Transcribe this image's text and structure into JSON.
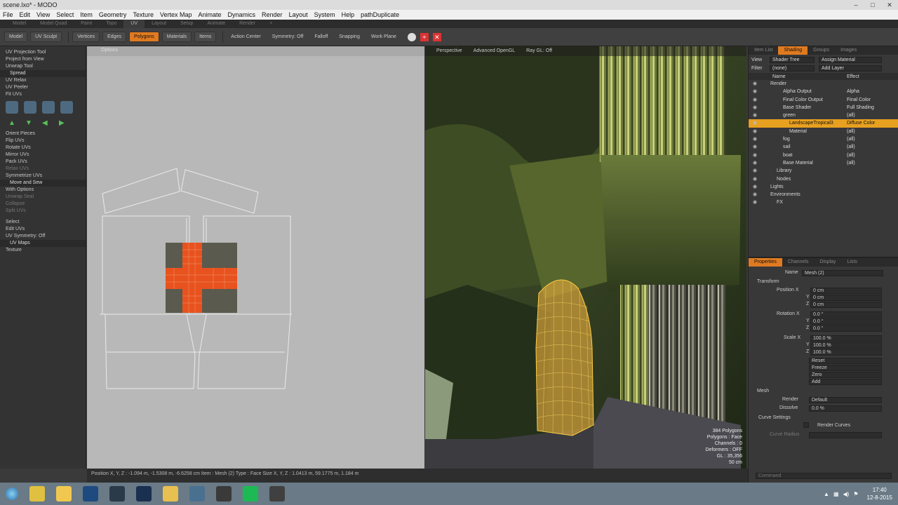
{
  "window": {
    "title": "scene.lxo* - MODO"
  },
  "menu": [
    "File",
    "Edit",
    "View",
    "Select",
    "Item",
    "Geometry",
    "Texture",
    "Vertex Map",
    "Animate",
    "Dynamics",
    "Render",
    "Layout",
    "System",
    "Help",
    "pathDuplicate"
  ],
  "layout_tabs": [
    "Model",
    "Model Quad",
    "Paint",
    "Topo",
    "UV",
    "Layout",
    "Setup",
    "Animate",
    "Render",
    "+"
  ],
  "layout_active": "UV",
  "toolbar": {
    "model": "Model",
    "uv_sculpt": "UV Sculpt",
    "vertices": "Vertices",
    "edges": "Edges",
    "polygons": "Polygons",
    "materials": "Materials",
    "items": "Items",
    "action_center": "Action Center",
    "symmetry": "Symmetry: Off",
    "falloff": "Falloff",
    "snapping": "Snapping",
    "work_plane": "Work Plane"
  },
  "left_panel": {
    "items": [
      {
        "label": "UV Projection Tool"
      },
      {
        "label": "Project from View"
      },
      {
        "label": "Unwrap Tool"
      },
      {
        "label": "Spread",
        "head": true
      },
      {
        "label": "UV Relax"
      },
      {
        "label": "UV Peeler"
      },
      {
        "label": "Fit UVs"
      }
    ],
    "items2": [
      {
        "label": "Orient Pieces"
      },
      {
        "label": "Flip UVs"
      },
      {
        "label": "Rotate UVs"
      },
      {
        "label": "Mirror UVs"
      },
      {
        "label": "Pack UVs"
      },
      {
        "label": "Relax UVs",
        "dim": true
      },
      {
        "label": "Symmetrize UVs"
      },
      {
        "label": "Move and Sew",
        "head": true
      },
      {
        "label": "With Options"
      },
      {
        "label": "Unwrap Seal",
        "dim": true
      },
      {
        "label": "Collapse",
        "dim": true
      },
      {
        "label": "Split UVs",
        "dim": true
      }
    ],
    "items3": [
      {
        "label": "Select"
      },
      {
        "label": "Edit UVs"
      },
      {
        "label": "UV Symmetry: Off"
      },
      {
        "label": "UV Maps",
        "head": true
      },
      {
        "label": "Texture"
      }
    ]
  },
  "uv_view": {
    "options_label": "Options"
  },
  "viewport": {
    "tabs": [
      "Perspective",
      "Advanced OpenGL",
      "Ray GL: Off"
    ],
    "stats": [
      "384 Polygons",
      "Polygons : Face",
      "Channels : 0",
      "Deformers : OFF",
      "GL : 35,356",
      "50 cm"
    ]
  },
  "right_panel": {
    "tabs": [
      "Item List",
      "Shading",
      "Groups",
      "Images"
    ],
    "active_tab": "Shading",
    "view_label": "View",
    "view_value": "Shader Tree",
    "assign_material": "Assign Material",
    "filter_label": "Filter",
    "filter_value": "(none)",
    "add_layer": "Add Layer",
    "col_name": "Name",
    "col_effect": "Effect",
    "tree": [
      {
        "label": "Render",
        "indent": 1,
        "effect": ""
      },
      {
        "label": "Alpha Output",
        "indent": 3,
        "effect": "Alpha"
      },
      {
        "label": "Final Color Output",
        "indent": 3,
        "effect": "Final Color"
      },
      {
        "label": "Base Shader",
        "indent": 3,
        "effect": "Full Shading"
      },
      {
        "label": "green",
        "indent": 3,
        "effect": "(all)"
      },
      {
        "label": "LandscapeTropical3",
        "indent": 4,
        "effect": "Diffuse Color",
        "selected": true
      },
      {
        "label": "Material",
        "indent": 4,
        "effect": "(all)"
      },
      {
        "label": "fog",
        "indent": 3,
        "effect": "(all)"
      },
      {
        "label": "sail",
        "indent": 3,
        "effect": "(all)"
      },
      {
        "label": "boat",
        "indent": 3,
        "effect": "(all)"
      },
      {
        "label": "Base Material",
        "indent": 3,
        "effect": "(all)"
      },
      {
        "label": "Library",
        "indent": 2,
        "effect": ""
      },
      {
        "label": "Nodes",
        "indent": 2,
        "effect": ""
      },
      {
        "label": "Lights",
        "indent": 1,
        "effect": ""
      },
      {
        "label": "Environments",
        "indent": 1,
        "effect": ""
      },
      {
        "label": "FX",
        "indent": 2,
        "effect": ""
      }
    ],
    "prop_tabs": [
      "Properties",
      "Channels",
      "Display",
      "Lists"
    ],
    "name_label": "Name",
    "name_value": "Mesh (2)",
    "transform_label": "Transform",
    "position_label": "Position X",
    "position": [
      "0 cm",
      "0 cm",
      "0 cm"
    ],
    "rotation_label": "Rotation X",
    "rotation": [
      "0.0 °",
      "0.0 °",
      "0.0 °"
    ],
    "scale_label": "Scale X",
    "scale": [
      "100.0 %",
      "100.0 %",
      "100.0 %"
    ],
    "axis_y": "Y",
    "axis_z": "Z",
    "reset": "Reset",
    "freeze": "Freeze",
    "zero": "Zero",
    "add": "Add",
    "mesh_label": "Mesh",
    "render_label": "Render",
    "render_value": "Default",
    "dissolve_label": "Dissolve",
    "dissolve_value": "0.0 %",
    "curve_settings": "Curve Settings",
    "render_curves": "Render Curves",
    "curve_radius": "Curve Radius",
    "command_placeholder": "Command"
  },
  "status": "Position X, Y, Z : -1.094 m, -1.5308 m, -6.6258 cm   Item : Mesh (2)   Type : Face   Size X, Y, Z : 1.0413 m, 59.1775 m, 1.184 m",
  "taskbar": {
    "time": "17:40",
    "date": "12-8-2015",
    "apps": [
      "chrome-icon",
      "explorer-icon",
      "photoshop-icon",
      "modo-icon",
      "steam-icon",
      "folder-icon",
      "notepad-icon",
      "inkscape-icon",
      "spotify-icon",
      "cinema-icon"
    ]
  }
}
